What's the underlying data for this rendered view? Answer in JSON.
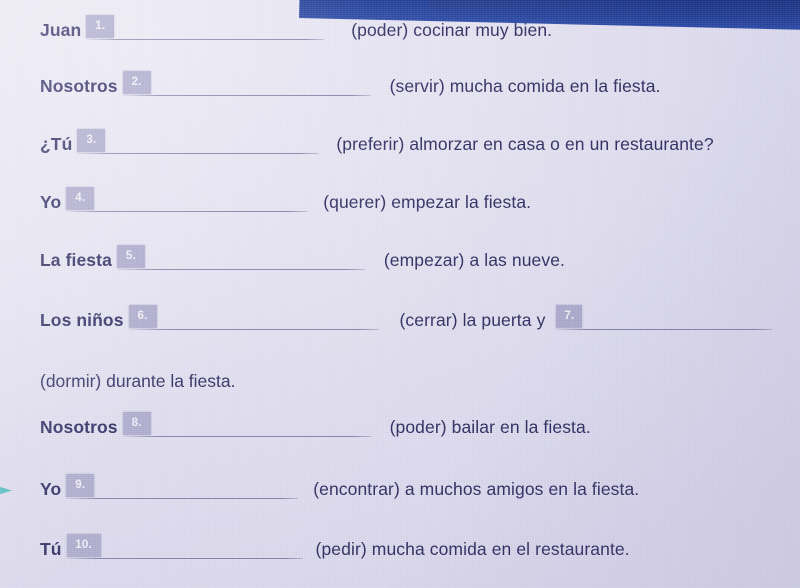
{
  "document": {
    "type": "spanish-verb-conjugation-worksheet",
    "language": "Spanish",
    "background_color": "#e2e0f0",
    "text_color": "#2f2c60",
    "chip_color": "#adaacd",
    "rule_color": "#6d6896",
    "top_band_color": "#1b3a95",
    "marker_color": "#37b6b6"
  },
  "exercises": [
    {
      "number": "1.",
      "subject": "Juan",
      "prompt": "(poder) cocinar muy bien.",
      "continuation": ""
    },
    {
      "number": "2.",
      "subject": "Nosotros",
      "prompt": "(servir) mucha comida en la fiesta.",
      "continuation": ""
    },
    {
      "number": "3.",
      "subject": "¿Tú",
      "prompt": "(preferir) almorzar en casa o en un restaurante?",
      "continuation": ""
    },
    {
      "number": "4.",
      "subject": "Yo",
      "prompt": "(querer) empezar la fiesta.",
      "continuation": ""
    },
    {
      "number": "5.",
      "subject": "La fiesta",
      "prompt": "(empezar) a las nueve.",
      "continuation": ""
    },
    {
      "number": "6.",
      "subject": "Los niños",
      "prompt": "(cerrar) la puerta y",
      "continuation": "(dormir) durante la fiesta."
    },
    {
      "number": "7.",
      "subject": "",
      "prompt": "",
      "continuation": ""
    },
    {
      "number": "8.",
      "subject": "Nosotros",
      "prompt": "(poder) bailar en la fiesta.",
      "continuation": ""
    },
    {
      "number": "9.",
      "subject": "Yo",
      "prompt": "(encontrar) a muchos amigos en la fiesta.",
      "continuation": ""
    },
    {
      "number": "10.",
      "subject": "Tú",
      "prompt": "(pedir) mucha comida en el restaurante.",
      "continuation": ""
    }
  ]
}
